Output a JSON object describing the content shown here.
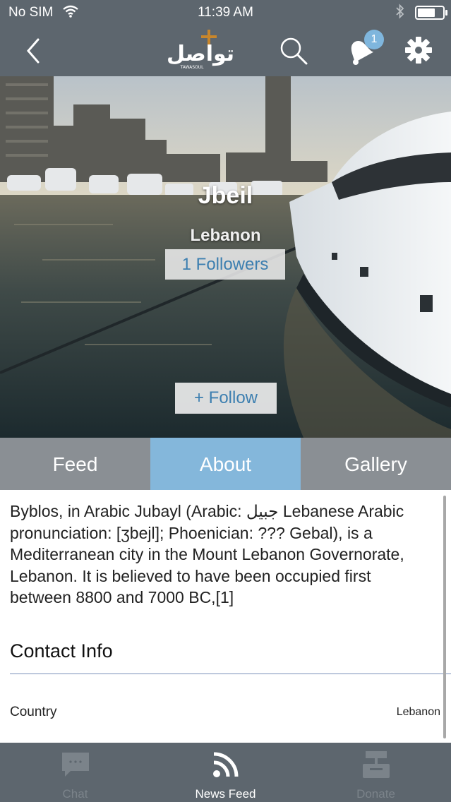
{
  "status_bar": {
    "carrier": "No SIM",
    "time": "11:39 AM"
  },
  "nav": {
    "logo_text": "تواصل",
    "logo_subtext": "TAWASOUL",
    "notification_count": "1",
    "icons": [
      "back-chevron-icon",
      "search-icon",
      "bell-icon",
      "gear-icon"
    ]
  },
  "profile": {
    "name": "Jbeil",
    "country": "Lebanon",
    "followers_label": "1 Followers",
    "follow_button": "+ Follow"
  },
  "tabs": [
    {
      "label": "Feed",
      "active": false
    },
    {
      "label": "About",
      "active": true
    },
    {
      "label": "Gallery",
      "active": false
    }
  ],
  "about": {
    "description": "Byblos, in Arabic Jubayl (Arabic: جبيل  Lebanese Arabic pronunciation: [ʒbejl]; Phoenician: ??? Gebal), is a Mediterranean city in the Mount Lebanon Governorate, Lebanon. It is believed to have been occupied first between 8800 and 7000 BC,[1]",
    "contact_title": "Contact Info",
    "fields": [
      {
        "label": "Country",
        "value": "Lebanon"
      }
    ]
  },
  "bottom_nav": [
    {
      "label": "Chat",
      "icon": "chat-bubble-icon",
      "active": false
    },
    {
      "label": "News Feed",
      "icon": "rss-feed-icon",
      "active": true
    },
    {
      "label": "Donate",
      "icon": "donate-box-icon",
      "active": false
    }
  ],
  "colors": {
    "bar": "#5d666e",
    "tab_bar": "#8a8f94",
    "tab_active": "#84b7db",
    "link_blue": "#3d7fb0",
    "badge": "#7fb6dd"
  }
}
